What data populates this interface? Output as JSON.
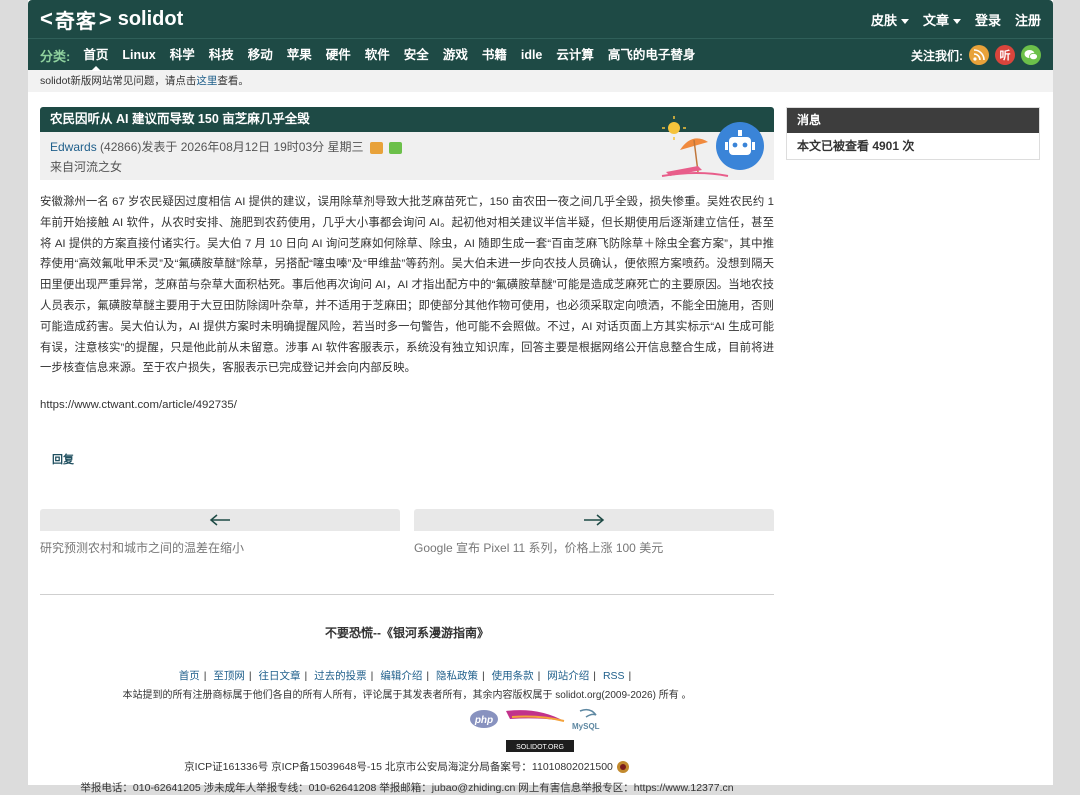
{
  "header": {
    "logo_left": "<",
    "logo_qike": "奇客",
    "logo_right": ">",
    "logo_site": "solidot",
    "skin": "皮肤",
    "article": "文章",
    "login": "登录",
    "register": "注册"
  },
  "nav": {
    "label": "分类:",
    "items": [
      "首页",
      "Linux",
      "科学",
      "科技",
      "移动",
      "苹果",
      "硬件",
      "软件",
      "安全",
      "游戏",
      "书籍",
      "idle",
      "云计算",
      "高飞的电子替身"
    ],
    "follow": "关注我们:",
    "icon_rss": "RSS",
    "icon_listen": "听",
    "icon_wechat": "微"
  },
  "notice": {
    "text_before": "solidot新版网站常见问题，请点击",
    "link": "这里",
    "text_after": "查看。"
  },
  "article": {
    "title": "农民因听从 AI 建议而导致 150 亩芝麻几乎全毁",
    "author": "Edwards",
    "meta": " (42866)发表于 2026年08月12日 19时03分 星期三",
    "source": "来自河流之女",
    "body": "安徽滁州一名 67 岁农民疑因过度相信 AI 提供的建议，误用除草剂导致大批芝麻苗死亡，150 亩农田一夜之间几乎全毁，损失惨重。吴姓农民约 1 年前开始接触 AI 软件，从农时安排、施肥到农药使用，几乎大小事都会询问 AI。起初他对相关建议半信半疑，但长期使用后逐渐建立信任，甚至将 AI 提供的方案直接付诸实行。吴大伯 7 月 10 日向 AI 询问芝麻如何除草、除虫，AI 随即生成一套“百亩芝麻飞防除草＋除虫全套方案”，其中推荐使用“高效氟吡甲禾灵”及“氟磺胺草醚”除草，另搭配“噻虫嗪”及“甲维盐”等药剂。吴大伯未进一步向农技人员确认，便依照方案喷药。没想到隔天田里便出现严重异常，芝麻苗与杂草大面积枯死。事后他再次询问 AI，AI 才指出配方中的“氟磺胺草醚”可能是造成芝麻死亡的主要原因。当地农技人员表示，氟磺胺草醚主要用于大豆田防除阔叶杂草，并不适用于芝麻田；即使部分其他作物可使用，也必须采取定向喷洒，不能全田施用，否则可能造成药害。吴大伯认为，AI 提供方案时未明确提醒风险，若当时多一句警告，他可能不会照做。不过，AI 对话页面上方其实标示“AI 生成可能有误，注意核实”的提醒，只是他此前从未留意。涉事 AI 软件客服表示，系统没有独立知识库，回答主要是根据网络公开信息整合生成，目前将进一步核查信息来源。至于农户损失，客服表示已完成登记并会向内部反映。",
    "link": "https://www.ctwant.com/article/492735/",
    "reply": "回复",
    "prev_title": "研究预测农村和城市之间的温差在缩小",
    "next_title": "Google 宣布 Pixel 11 系列，价格上涨 100 美元"
  },
  "sidebar": {
    "head": "消息",
    "views": "本文已被查看 4901 次"
  },
  "footer": {
    "quote": "不要恐慌--《银河系漫游指南》",
    "links": [
      "首页",
      "至顶网",
      "往日文章",
      "过去的投票",
      "编辑介绍",
      "隐私政策",
      "使用条款",
      "网站介绍",
      "RSS"
    ],
    "copyright": "本站提到的所有注册商标属于他们各自的所有人所有，评论属于其发表者所有，其余内容版权属于 solidot.org(2009-2026) 所有 。",
    "badge_php": "php",
    "badge_mysql": "MySQL",
    "badge_solidot": "SOLIDOT.ORG",
    "icp": "京ICP证161336号    京ICP备15039648号-15 北京市公安局海淀分局备案号：11010802021500",
    "report": "举报电话：010-62641205    涉未成年人举报专线：010-62641208 举报邮箱：jubao@zhiding.cn    网上有害信息举报专区：https://www.12377.cn"
  },
  "colors": {
    "header_bg": "#1e4a45",
    "nav_label": "#8fd19e",
    "sidebar_head": "#3d3d3d",
    "link": "#1f5f8b"
  }
}
